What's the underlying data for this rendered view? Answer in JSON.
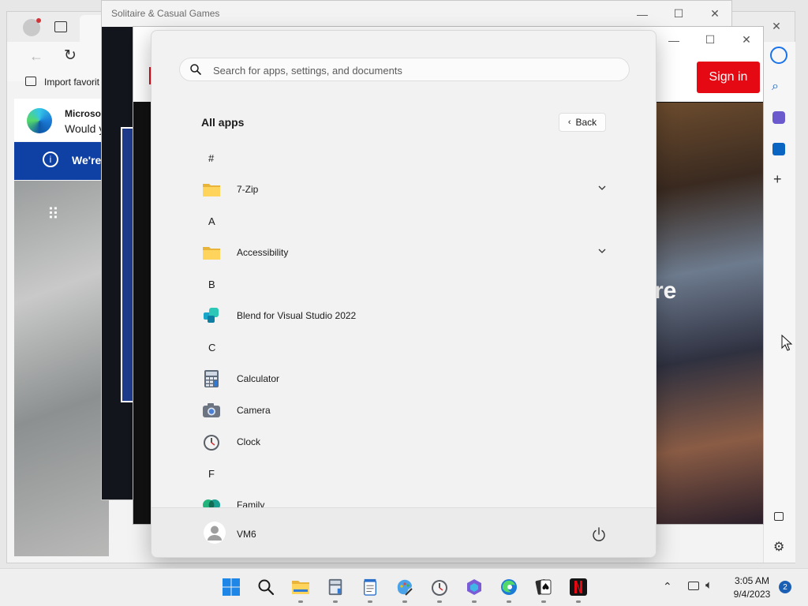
{
  "edge": {
    "favorites_label": "Import favorit",
    "notice_title": "Microso",
    "notice_body": "Would y",
    "info_text": "We're"
  },
  "solitaire": {
    "title": "Solitaire & Casual Games"
  },
  "netflix": {
    "signin_label": "Sign in",
    "hero_fragment": "re"
  },
  "start_menu": {
    "search_placeholder": "Search for apps, settings, and documents",
    "all_apps_label": "All apps",
    "back_label": "Back",
    "groups": [
      {
        "letter": "#",
        "apps": [
          {
            "name": "7-Zip",
            "icon": "folder-icon",
            "expandable": true
          }
        ]
      },
      {
        "letter": "A",
        "apps": [
          {
            "name": "Accessibility",
            "icon": "folder-icon",
            "expandable": true
          }
        ]
      },
      {
        "letter": "B",
        "apps": [
          {
            "name": "Blend for Visual Studio 2022",
            "icon": "blend-icon",
            "expandable": false
          }
        ]
      },
      {
        "letter": "C",
        "apps": [
          {
            "name": "Calculator",
            "icon": "calculator-icon",
            "expandable": false
          },
          {
            "name": "Camera",
            "icon": "camera-icon",
            "expandable": false
          },
          {
            "name": "Clock",
            "icon": "clock-icon",
            "expandable": false
          }
        ]
      },
      {
        "letter": "F",
        "apps": [
          {
            "name": "Family",
            "icon": "family-icon",
            "expandable": false
          }
        ]
      }
    ],
    "user_name": "VM6"
  },
  "taskbar": {
    "apps": [
      "windows-start-icon",
      "search-icon",
      "file-explorer-icon",
      "calculator-icon",
      "notepad-icon",
      "paint-icon",
      "clock-icon",
      "copilot-icon",
      "edge-icon",
      "solitaire-icon",
      "netflix-icon"
    ],
    "time": "3:05 AM",
    "date": "9/4/2023",
    "notification_count": "2"
  },
  "colors": {
    "accent": "#0067c0",
    "netflix_red": "#e50914",
    "edge_info_blue": "#0f40a3"
  }
}
